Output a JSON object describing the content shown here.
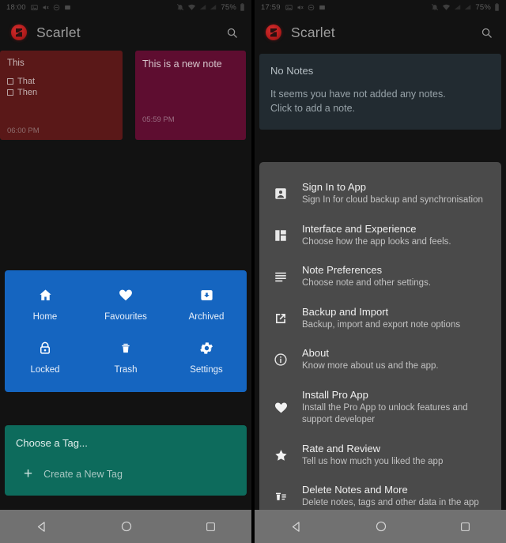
{
  "left": {
    "statusbar": {
      "time": "18:00",
      "battery": "75%",
      "icons_left": [
        "image-icon",
        "mute-icon",
        "dnd-icon",
        "screenshot-icon"
      ],
      "icons_right": [
        "notifications-off-icon",
        "wifi-icon",
        "signal-icon",
        "signal-icon",
        "battery-icon"
      ]
    },
    "appbar": {
      "title": "Scarlet",
      "logo": "scarlet-logo-icon",
      "search": "search-icon"
    },
    "notes": [
      {
        "title": "This",
        "items": [
          "That",
          "Then"
        ],
        "time": "06:00 PM",
        "color": "#5a1818"
      },
      {
        "title": "This is a new note",
        "items": [],
        "time": "05:59 PM",
        "color": "#5e0d30"
      }
    ],
    "quickgrid": {
      "color": "#1565c0",
      "items": [
        {
          "label": "Home",
          "icon": "home-icon"
        },
        {
          "label": "Favourites",
          "icon": "heart-icon"
        },
        {
          "label": "Archived",
          "icon": "archive-icon"
        },
        {
          "label": "Locked",
          "icon": "lock-icon"
        },
        {
          "label": "Trash",
          "icon": "trash-icon"
        },
        {
          "label": "Settings",
          "icon": "gear-icon"
        }
      ]
    },
    "tagcard": {
      "color": "#0d6b5c",
      "title": "Choose a Tag...",
      "create_label": "Create a New Tag",
      "plus": "+"
    }
  },
  "right": {
    "statusbar": {
      "time": "17:59",
      "battery": "75%"
    },
    "appbar": {
      "title": "Scarlet",
      "logo": "scarlet-logo-icon",
      "search": "search-icon"
    },
    "empty": {
      "title": "No Notes",
      "line1": "It seems you have not added any notes.",
      "line2": "Click to add a note."
    },
    "sheet": {
      "color": "#4a4a4a",
      "items": [
        {
          "title": "Sign In to App",
          "desc": "Sign In for cloud backup and synchronisation",
          "icon": "account-box-icon"
        },
        {
          "title": "Interface and Experience",
          "desc": "Choose how the app looks and feels.",
          "icon": "dashboard-icon"
        },
        {
          "title": "Note Preferences",
          "desc": "Choose note and other settings.",
          "icon": "list-lines-icon"
        },
        {
          "title": "Backup and Import",
          "desc": "Backup, import and export note options",
          "icon": "open-in-new-icon"
        },
        {
          "title": "About",
          "desc": "Know more about us and the app.",
          "icon": "info-icon"
        },
        {
          "title": "Install Pro App",
          "desc": "Install the Pro App to unlock features and support developer",
          "icon": "heart-icon"
        },
        {
          "title": "Rate and Review",
          "desc": "Tell us how much you liked the app",
          "icon": "star-icon"
        },
        {
          "title": "Delete Notes and More",
          "desc": "Delete notes, tags and other data in the app",
          "icon": "delete-sweep-icon"
        }
      ]
    }
  },
  "navbar": {
    "back": "back-triangle-icon",
    "home": "home-circle-icon",
    "recents": "recents-square-icon"
  }
}
